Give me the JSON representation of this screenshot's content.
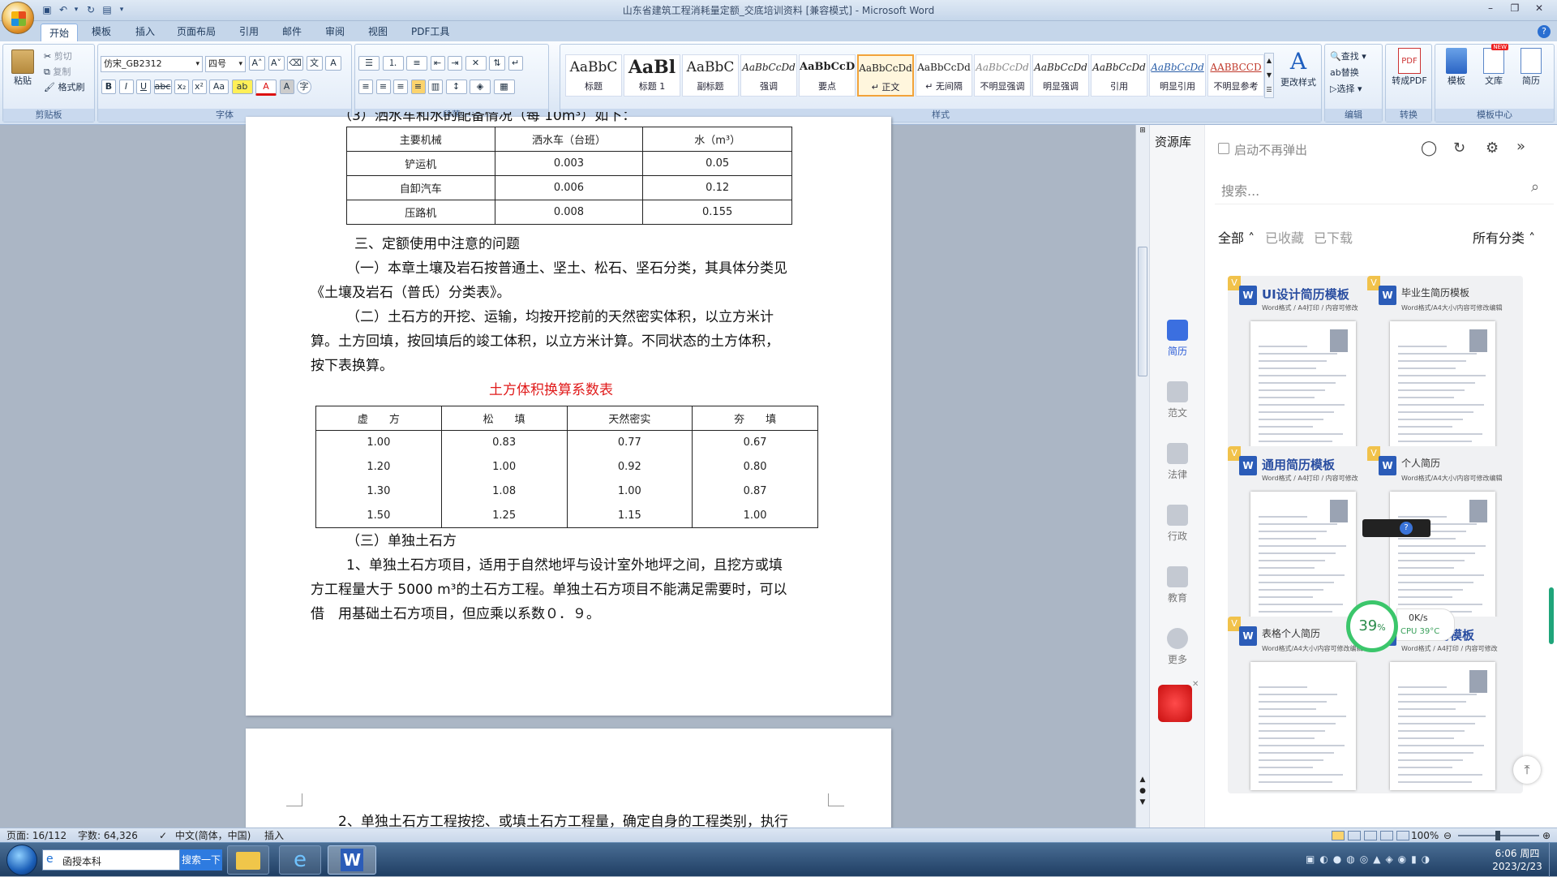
{
  "window": {
    "title": "山东省建筑工程消耗量定额_交底培训资料 [兼容模式] - Microsoft Word"
  },
  "tabs": [
    "开始",
    "模板",
    "插入",
    "页面布局",
    "引用",
    "邮件",
    "审阅",
    "视图",
    "PDF工具"
  ],
  "ribbon": {
    "clipboard": {
      "paste": "粘贴",
      "cut": "剪切",
      "copy": "复制",
      "painter": "格式刷",
      "label": "剪贴板"
    },
    "font": {
      "name": "仿宋_GB2312",
      "size": "四号",
      "label": "字体"
    },
    "paragraph": {
      "label": "段落"
    },
    "styles": {
      "label": "样式",
      "items": [
        {
          "sample": "AaBbC",
          "name": "标题"
        },
        {
          "sample": "AaBl",
          "name": "标题 1"
        },
        {
          "sample": "AaBbC",
          "name": "副标题"
        },
        {
          "sample": "AaBbCcDd",
          "name": "强调"
        },
        {
          "sample": "AaBbCcD",
          "name": "要点"
        },
        {
          "sample": "AaBbCcDd",
          "name": "↵ 正文"
        },
        {
          "sample": "AaBbCcDd",
          "name": "↵ 无间隔"
        },
        {
          "sample": "AaBbCcDd",
          "name": "不明显强调"
        },
        {
          "sample": "AaBbCcDd",
          "name": "明显强调"
        },
        {
          "sample": "AaBbCcDd",
          "name": "引用"
        },
        {
          "sample": "AaBbCcDd",
          "name": "明显引用"
        },
        {
          "sample": "AABBCCD",
          "name": "不明显参考"
        }
      ],
      "change": "更改样式"
    },
    "editing": {
      "find": "查找",
      "replace": "替换",
      "select": "选择",
      "label": "编辑"
    },
    "convert": {
      "topdf": "转成PDF",
      "label": "转换"
    },
    "template": {
      "t1": "模板",
      "t2": "文库",
      "t3": "简历",
      "label": "模板中心"
    }
  },
  "document": {
    "top_cut_line": "（3）洒水车和水的配备情况（每 10m³）如下：",
    "table1": {
      "headers": [
        "主要机械",
        "洒水车（台班）",
        "水（m³）"
      ],
      "rows": [
        [
          "铲运机",
          "0.003",
          "0.05"
        ],
        [
          "自卸汽车",
          "0.006",
          "0.12"
        ],
        [
          "压路机",
          "0.008",
          "0.155"
        ]
      ]
    },
    "heading3": "三、定额使用中注意的问题",
    "p1a": "（一）本章土壤及岩石按普通土、坚土、松石、坚石分类，其具体分类见",
    "p1b": "《土壤及岩石（普氏）分类表》。",
    "p2a": "（二）土石方的开挖、运输，均按开挖前的天然密实体积，以立方米计",
    "p2b": "算。土方回填，按回填后的竣工体积，以立方米计算。不同状态的土方体积，",
    "p2c": "按下表换算。",
    "table2_title": "土方体积换算系数表",
    "table2": {
      "headers": [
        "虚　　方",
        "松　　填",
        "天然密实",
        "夯　　填"
      ],
      "rows": [
        [
          "1.00",
          "0.83",
          "0.77",
          "0.67"
        ],
        [
          "1.20",
          "1.00",
          "0.92",
          "0.80"
        ],
        [
          "1.30",
          "1.08",
          "1.00",
          "0.87"
        ],
        [
          "1.50",
          "1.25",
          "1.15",
          "1.00"
        ]
      ]
    },
    "p3": "（三）单独土石方",
    "p4a": "1、单独土石方项目，适用于自然地坪与设计室外地坪之间，且挖方或填",
    "p4b": "方工程量大于 5000  m³的土石方工程。单独土石方项目不能满足需要时，可以",
    "p4c": "借　用基础土石方项目，但应乘以系数０．９。",
    "page2_line": "2、单独土石方工程按挖、或填土石方工程量，确定自身的工程类别，执行"
  },
  "panel": {
    "title": "资源库",
    "checkbox": "启动不再弹出",
    "search_placeholder": "搜索...",
    "filters": {
      "all": "全部",
      "saved": "已收藏",
      "downloaded": "已下载",
      "category": "所有分类"
    },
    "nav": [
      "简历",
      "范文",
      "法律",
      "行政",
      "教育",
      "更多"
    ],
    "cards": [
      {
        "title": "UI设计简历模板",
        "sub": "Word格式 / A4打印 / 内容可修改",
        "badge": "V"
      },
      {
        "title": "毕业生简历模板",
        "sub": "Word格式/A4大小/内容可修改编辑",
        "badge": "V"
      },
      {
        "title": "通用简历模板",
        "sub": "Word格式 / A4打印 / 内容可修改",
        "badge": "V"
      },
      {
        "title": "个人简历",
        "sub": "Word格式/A4大小/内容可修改编辑",
        "badge": "V"
      },
      {
        "title": "表格个人简历",
        "sub": "Word格式/A4大小/内容可修改编辑",
        "badge": "V"
      },
      {
        "title": "个人简历模板",
        "sub": "Word格式 / A4打印 / 内容可修改",
        "badge": "V"
      }
    ]
  },
  "monitor": {
    "percent": "39",
    "percent_sign": "%",
    "net": "0K/s",
    "cpu": "CPU 39°C"
  },
  "status": {
    "page": "页面: 16/112",
    "words": "字数: 64,326",
    "lang": "中文(简体，中国)",
    "mode": "插入",
    "zoom": "100%"
  },
  "taskbar": {
    "ie_text": "函授本科",
    "search_btn": "搜索一下",
    "time": "6:06 周四",
    "date": "2023/2/23"
  }
}
